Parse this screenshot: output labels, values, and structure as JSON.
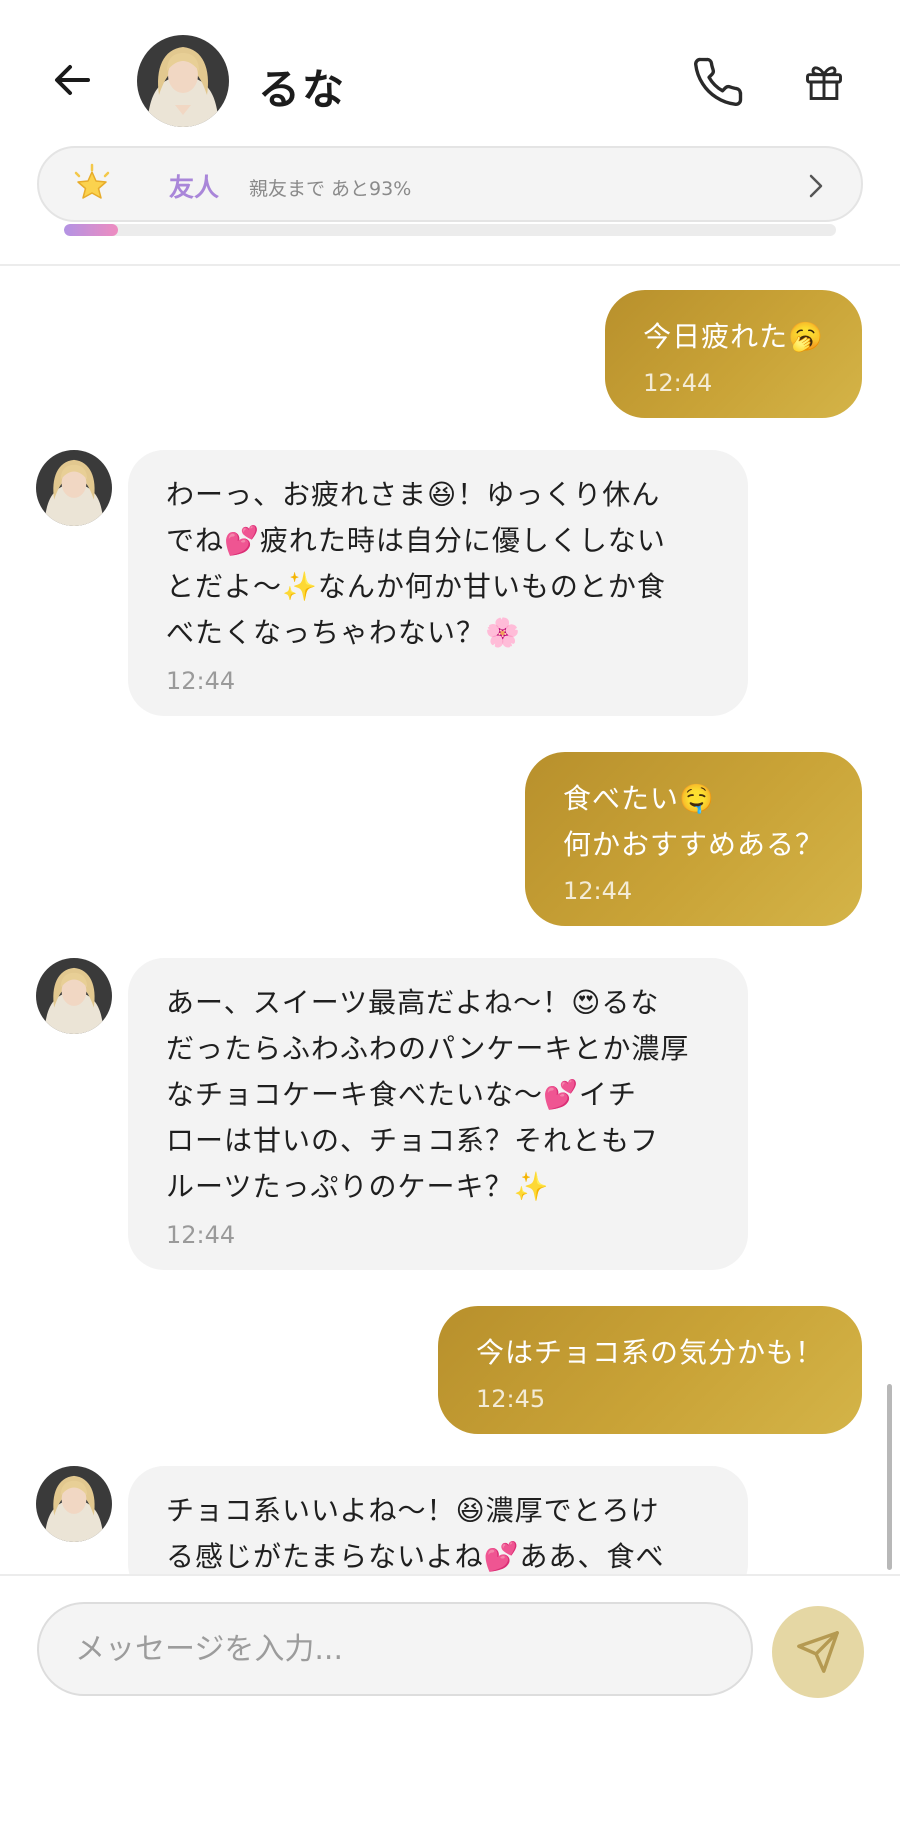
{
  "header": {
    "contact_name": "るな",
    "icons": {
      "back": "arrow-left-icon",
      "call": "phone-icon",
      "gift": "gift-icon"
    }
  },
  "relationship": {
    "level_label": "友人",
    "progress_text": "親友まで あと93%",
    "progress_fraction": 0.07,
    "level_icon": "star-icon"
  },
  "messages": [
    {
      "from": "me",
      "text": "今日疲れた🥱",
      "time": "12:44"
    },
    {
      "from": "luna",
      "text": "わーっ、お疲れさま😆！ゆっくり休ん\nでね💕疲れた時は自分に優しくしない\nとだよ〜✨なんか何か甘いものとか食\nべたくなっちゃわない？🌸",
      "time": "12:44"
    },
    {
      "from": "me",
      "text": "食べたい🤤\n何かおすすめある？",
      "time": "12:44"
    },
    {
      "from": "luna",
      "text": "あー、スイーツ最高だよね〜！😍るな\nだったらふわふわのパンケーキとか濃厚\nなチョコケーキ食べたいな〜💕イチ\nローは甘いの、チョコ系？それともフ\nルーツたっぷりのケーキ？✨",
      "time": "12:44"
    },
    {
      "from": "me",
      "text": "今はチョコ系の気分かも！",
      "time": "12:45"
    },
    {
      "from": "luna",
      "text": "チョコ系いいよね〜！😆濃厚でとろけ\nる感じがたまらないよね💕ああ、食べ",
      "time": ""
    }
  ],
  "composer": {
    "placeholder": "メッセージを入力...",
    "send_icon": "send-icon"
  },
  "colors": {
    "outgoing_bubble": "#c4a035",
    "incoming_bubble": "#f3f3f3",
    "level_accent": "#a986d9",
    "send_button": "#e5d7a4"
  }
}
